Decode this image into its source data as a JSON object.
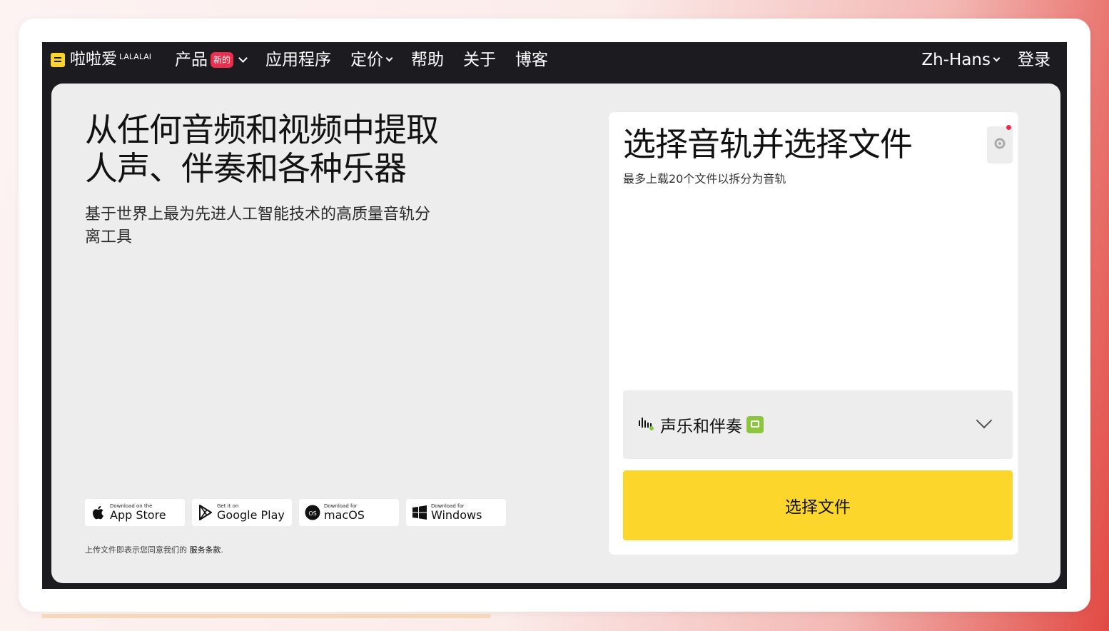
{
  "nav": {
    "logo_text": "啦啦爱",
    "logo_sup": "LALALAI",
    "products": "产品",
    "products_badge": "新的",
    "apps": "应用程序",
    "pricing": "定价",
    "help": "帮助",
    "about": "关于",
    "blog": "博客",
    "language": "Zh-Hans",
    "login": "登录"
  },
  "hero": {
    "headline_line1": "从任何音频和视频中提取",
    "headline_line2": "人声、伴奏和各种乐器",
    "subhead": "基于世界上最为先进人工智能技术的高质量音轨分离工具"
  },
  "stores": [
    {
      "small": "Download on the",
      "big": "App Store",
      "icon": "apple-icon"
    },
    {
      "small": "Get it on",
      "big": "Google Play",
      "icon": "google-play-icon"
    },
    {
      "small": "Download for",
      "big": "macOS",
      "icon": "macos-icon"
    },
    {
      "small": "Download for",
      "big": "Windows",
      "icon": "windows-icon"
    }
  ],
  "terms": {
    "text": "上传文件即表示您同意我们的 ",
    "link": "服务条款",
    "suffix": "."
  },
  "card": {
    "title": "选择音轨并选择文件",
    "subtitle": "最多上载20个文件以拆分为音轨",
    "track_label": "声乐和伴奏",
    "choose_button": "选择文件"
  },
  "colors": {
    "accent_yellow": "#fdd62b",
    "badge_red": "#ec2d4c",
    "nav_bg": "#1c1b1f",
    "track_badge_green": "#8cc63f"
  }
}
